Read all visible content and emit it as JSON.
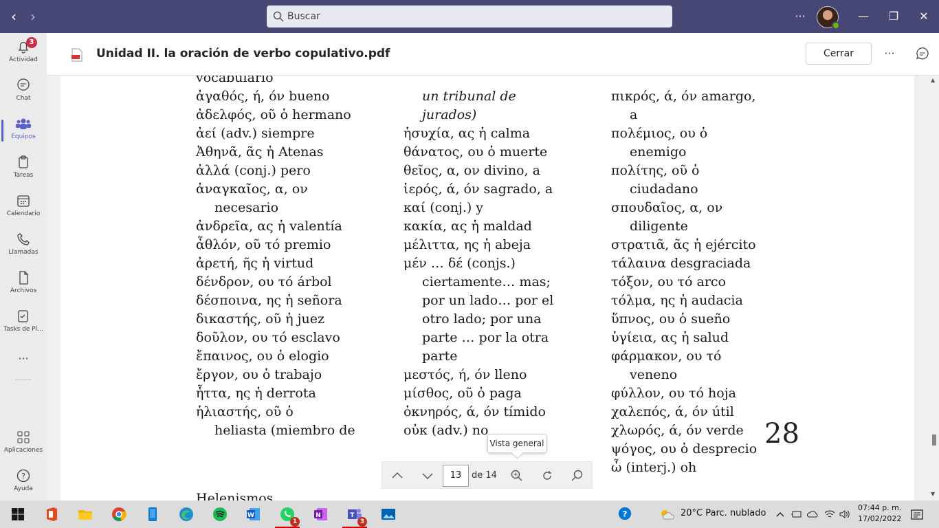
{
  "titlebar": {
    "search_placeholder": "Buscar",
    "more_label": "···",
    "minimize_label": "—",
    "maximize_label": "❐",
    "close_label": "✕",
    "back_label": "‹",
    "forward_label": "›"
  },
  "rail": {
    "items": [
      {
        "label": "Actividad",
        "icon": "bell-icon",
        "badge": "3"
      },
      {
        "label": "Chat",
        "icon": "chat-icon"
      },
      {
        "label": "Equipos",
        "icon": "teams-icon",
        "active": true
      },
      {
        "label": "Tareas",
        "icon": "clipboard-icon"
      },
      {
        "label": "Calendario",
        "icon": "calendar-icon"
      },
      {
        "label": "Llamadas",
        "icon": "phone-icon"
      },
      {
        "label": "Archivos",
        "icon": "file-icon"
      },
      {
        "label": "Tasks de Pl...",
        "icon": "tasks-icon"
      },
      {
        "label": "Aplicaciones",
        "icon": "apps-icon"
      },
      {
        "label": "Ayuda",
        "icon": "help-icon"
      }
    ],
    "more_label": "···"
  },
  "file": {
    "title": "Unidad II. la oración de verbo copulativo.pdf",
    "close_button": "Cerrar",
    "more_label": "···"
  },
  "document": {
    "col1": [
      {
        "text": "vocabulario",
        "style": ""
      },
      {
        "text": "ἀγαθός, ή, όν  bueno",
        "style": ""
      },
      {
        "text": "ἀδελφός, οῦ ὁ  hermano",
        "style": ""
      },
      {
        "text": "ἀεί  (adv.) siempre",
        "style": ""
      },
      {
        "text": "Ἀθηνᾶ, ᾶς ἡ  Atenas",
        "style": ""
      },
      {
        "text": "ἀλλά  (conj.) pero",
        "style": ""
      },
      {
        "text": "ἀναγκαῖος, α, ον",
        "style": ""
      },
      {
        "text": "necesario",
        "style": "ind"
      },
      {
        "text": "ἀνδρεῖα, ας ἡ  valentía",
        "style": ""
      },
      {
        "text": "ἆθλόν, οῦ τό  premio",
        "style": ""
      },
      {
        "text": "ἀρετή, ῆς ἡ  virtud",
        "style": ""
      },
      {
        "text": "δένδρον, ου τό  árbol",
        "style": ""
      },
      {
        "text": "δέσποινα, ης ἡ  señora",
        "style": ""
      },
      {
        "text": "δικαστής, οῦ ἡ  juez",
        "style": ""
      },
      {
        "text": "δοῦλον, ου τό  esclavo",
        "style": ""
      },
      {
        "text": "ἔπαινος, ου ὁ  elogio",
        "style": ""
      },
      {
        "text": "ἔργον, ου ὁ  trabajo",
        "style": ""
      },
      {
        "text": "ἧττα, ης ἡ  derrota",
        "style": ""
      },
      {
        "text": "ἡλιαστής, οῦ ὁ",
        "style": ""
      },
      {
        "text": "heliasta (miembro de",
        "style": "ind"
      }
    ],
    "col2": [
      {
        "text": "",
        "style": ""
      },
      {
        "text": "un tribunal de",
        "style": "ind it"
      },
      {
        "text": "jurados)",
        "style": "ind it"
      },
      {
        "text": "ἡσυχία, ας ἡ  calma",
        "style": ""
      },
      {
        "text": "θάνατος, ου ὁ  muerte",
        "style": ""
      },
      {
        "text": "θεῖος, α, ον  divino, a",
        "style": ""
      },
      {
        "text": "ἱερός, ά, όν  sagrado, a",
        "style": ""
      },
      {
        "text": "καί  (conj.) y",
        "style": ""
      },
      {
        "text": "κακία, ας ἡ  maldad",
        "style": ""
      },
      {
        "text": "μέλιττα, ης ἡ  abeja",
        "style": ""
      },
      {
        "text": "μέν … δέ  (conjs.)",
        "style": ""
      },
      {
        "text": "ciertamente… mas;",
        "style": "ind"
      },
      {
        "text": "por un lado… por el",
        "style": "ind"
      },
      {
        "text": "otro lado; por una",
        "style": "ind"
      },
      {
        "text": "parte … por la otra",
        "style": "ind"
      },
      {
        "text": "parte",
        "style": "ind"
      },
      {
        "text": "μεστός, ή, όν  lleno",
        "style": ""
      },
      {
        "text": "μίσθος, οῦ ὁ  paga",
        "style": ""
      },
      {
        "text": "ὀκνηρός, ά, όν  tímido",
        "style": ""
      },
      {
        "text": "οὐκ  (adv.) no",
        "style": ""
      }
    ],
    "col3": [
      {
        "text": "",
        "style": ""
      },
      {
        "text": "πικρός, ά, όν  amargo,",
        "style": ""
      },
      {
        "text": "a",
        "style": "ind"
      },
      {
        "text": "πολέμιος, ου ὁ",
        "style": ""
      },
      {
        "text": "enemigo",
        "style": "ind"
      },
      {
        "text": "πολίτης, οῦ ὁ",
        "style": ""
      },
      {
        "text": "ciudadano",
        "style": "ind"
      },
      {
        "text": "σπουδαῖος, α, ον",
        "style": ""
      },
      {
        "text": "diligente",
        "style": "ind"
      },
      {
        "text": "στρατιᾶ, ᾶς ἡ  ejército",
        "style": ""
      },
      {
        "text": "τάλαινα  desgraciada",
        "style": ""
      },
      {
        "text": "τόξον, ου τό  arco",
        "style": ""
      },
      {
        "text": "τόλμα, ης ἡ  audacia",
        "style": ""
      },
      {
        "text": "ὕπνος, ου ὁ  sueño",
        "style": ""
      },
      {
        "text": "ὑγίεια, ας ἡ  salud",
        "style": ""
      },
      {
        "text": "φάρμακον, ου τό",
        "style": ""
      },
      {
        "text": "veneno",
        "style": "ind"
      },
      {
        "text": "φύλλον, ου τό  hoja",
        "style": ""
      },
      {
        "text": "χαλεπός, ά, όν  útil",
        "style": ""
      },
      {
        "text": "χλωρός, ά, όν  verde",
        "style": ""
      },
      {
        "text": "ψόγος, ου ὁ  desprecio",
        "style": ""
      },
      {
        "text": "ὦ  (interj.) oh",
        "style": ""
      }
    ],
    "page_number": "28",
    "next_heading": "Helenismos"
  },
  "pdf_toolbar": {
    "current_page": "13",
    "of_pages": "de 14",
    "tooltip": "Vista general"
  },
  "taskbar": {
    "weather": "20°C  Parc. nublado",
    "time": "07:44 p. m.",
    "date": "17/02/2022",
    "whatsapp_badge": "1",
    "teams_badge": "3"
  },
  "colors": {
    "titlebar": "#464775",
    "accent": "#5b5fc7",
    "badge": "#c4314b"
  }
}
